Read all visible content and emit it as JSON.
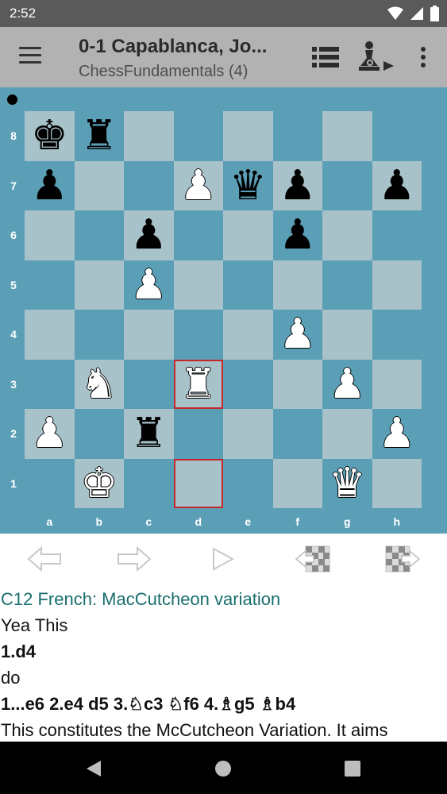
{
  "status_bar": {
    "time": "2:52"
  },
  "app_bar": {
    "title": "0-1 Capablanca, Jo...",
    "subtitle": "ChessFundamentals (4)",
    "menu_icon": "hamburger-menu-icon",
    "actions": [
      "list-icon",
      "engine-icon",
      "overflow-menu-icon"
    ]
  },
  "board": {
    "side_to_move": "black",
    "ranks": [
      "8",
      "7",
      "6",
      "5",
      "4",
      "3",
      "2",
      "1"
    ],
    "files": [
      "a",
      "b",
      "c",
      "d",
      "e",
      "f",
      "g",
      "h"
    ],
    "rows": [
      [
        "♚",
        "♜",
        "",
        "",
        "",
        "",
        "",
        ""
      ],
      [
        "♟",
        "",
        "",
        "♙",
        "♛",
        "♟",
        "",
        "♟"
      ],
      [
        "",
        "",
        "♟",
        "",
        "",
        "♟",
        "",
        ""
      ],
      [
        "",
        "",
        "♙",
        "",
        "",
        "",
        "",
        ""
      ],
      [
        "",
        "",
        "",
        "",
        "",
        "♙",
        "",
        ""
      ],
      [
        "",
        "♘",
        "",
        "♖",
        "",
        "",
        "♙",
        ""
      ],
      [
        "♙",
        "",
        "♜",
        "",
        "",
        "",
        "",
        "♙"
      ],
      [
        "",
        "♔",
        "",
        "",
        "",
        "",
        "♕",
        ""
      ]
    ],
    "highlighted_squares": [
      "d3",
      "d1"
    ],
    "colors": {
      "light": "#a8c2ca",
      "dark": "#5b9fb7",
      "highlight": "#c62828"
    }
  },
  "navigation": [
    "prev-move-icon",
    "next-move-icon",
    "play-icon",
    "prev-game-icon",
    "next-game-icon"
  ],
  "notes": [
    {
      "type": "opening",
      "text": "C12 French: MacCutcheon variation"
    },
    {
      "type": "comment",
      "text": "Yea This"
    },
    {
      "type": "move",
      "text": "1.d4"
    },
    {
      "type": "comment",
      "text": "do"
    },
    {
      "type": "move",
      "text": "1...e6 2.e4 d5 3.♘c3 ♘f6 4.♗g5 ♗b4"
    },
    {
      "type": "comment",
      "text": "This constitutes the McCutcheon Variation. It aims"
    }
  ],
  "system_nav": [
    "back-icon",
    "home-icon",
    "recents-icon"
  ]
}
